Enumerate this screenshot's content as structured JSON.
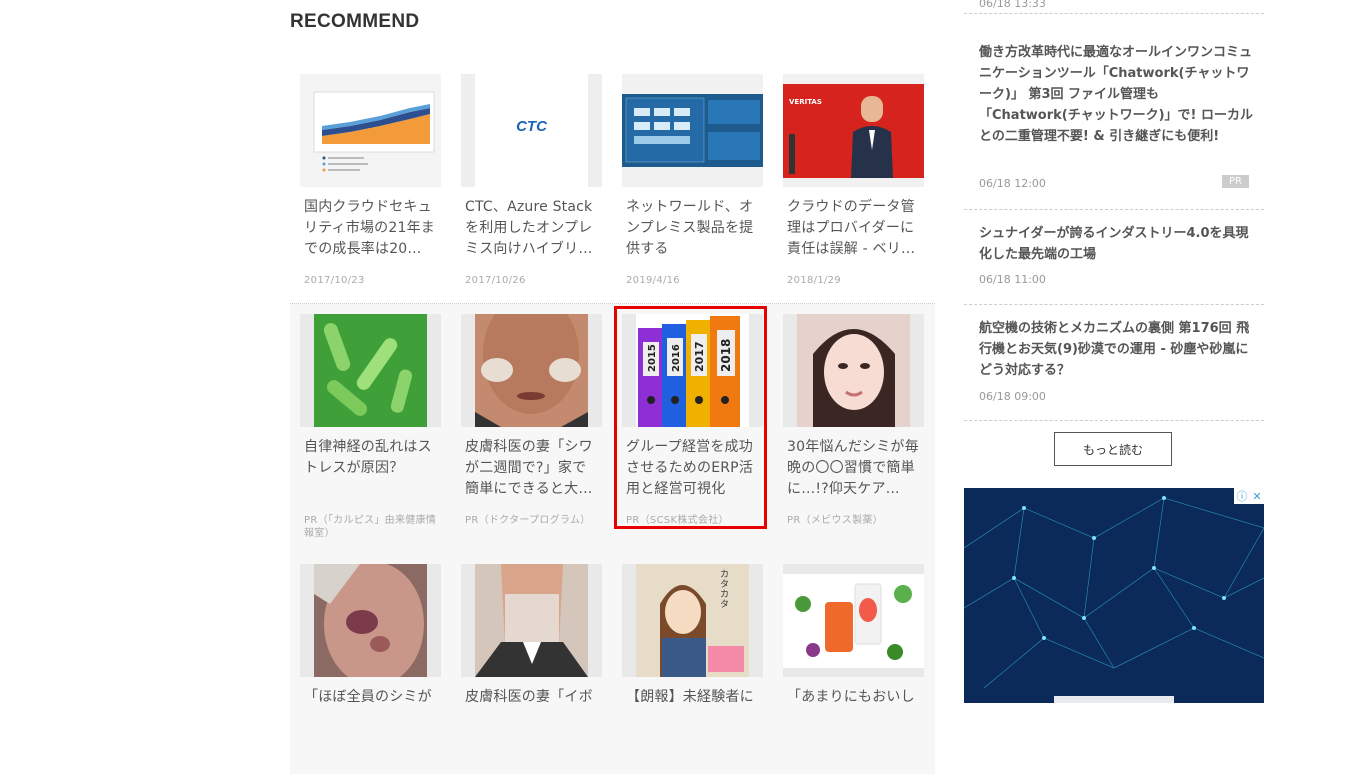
{
  "recommend": {
    "heading": "RECOMMEND",
    "row1": [
      {
        "title": "国内クラウドセキュリティ市場の21年までの成長率は20…",
        "date": "2017/10/23",
        "thumb": "chart-thumbnail"
      },
      {
        "title": "CTC、Azure Stackを利用したオンプレミス向けハイブリ…",
        "date": "2017/10/26",
        "thumb": "ctc-logo",
        "logo_text": "CTC"
      },
      {
        "title": "ネットワールド、オンプレミス製品を提供するStratoscale…",
        "date": "2019/4/16",
        "thumb": "diagram-thumbnail"
      },
      {
        "title": "クラウドのデータ管理はプロバイダーに責任は誤解 - ベリ…",
        "date": "2018/1/29",
        "thumb": "speaker-photo",
        "logo_text": "VERITAS"
      }
    ],
    "row2": [
      {
        "title": "自律神経の乱れはストレスが原因？",
        "source": "PR（「カルピス」由来健康情報室）",
        "thumb": "bacteria-image"
      },
      {
        "title": "皮膚科医の妻「シワが二週間で?」家で簡単にできると大…",
        "source": "PR（ドクタープログラム）",
        "thumb": "face-cream-photo"
      },
      {
        "title": "グループ経営を成功させるためのERP活用と経営可視化",
        "source": "PR（SCSK株式会社）",
        "thumb": "binders-image",
        "binder_years": [
          "2015",
          "2016",
          "2017",
          "2018"
        ]
      },
      {
        "title": "30年悩んだシミが毎晩の〇〇習慣で簡単に…!?仰天ケア…",
        "source": "PR（メビウス製薬）",
        "thumb": "woman-photo"
      }
    ],
    "row3": [
      {
        "title": "「ほぼ全員のシミが",
        "thumb": "face-spot-photo"
      },
      {
        "title": "皮膚科医の妻「イボ",
        "thumb": "neck-photo"
      },
      {
        "title": "【朗報】未経験者に",
        "thumb": "manga-thumbnail",
        "manga_text": "カタカタ"
      },
      {
        "title": "「あまりにもおいし",
        "thumb": "juice-photo"
      }
    ]
  },
  "sidebar": {
    "top_date": "06/18 13:33",
    "items": [
      {
        "title": "働き方改革時代に最適なオールインワンコミュニケーションツール「Chatwork(チャットワーク)」 第3回 ファイル管理も「Chatwork(チャットワーク)」で! ローカルとの二重管理不要! & 引き継ぎにも便利!",
        "date": "06/18 12:00",
        "badge": "PR"
      },
      {
        "title": "シュナイダーが誇るインダストリー4.0を具現化した最先端の工場",
        "date": "06/18 11:00"
      },
      {
        "title": "航空機の技術とメカニズムの裏側 第176回 飛行機とお天気(9)砂漠での運用 - 砂塵や砂嵐にどう対応する？",
        "date": "06/18 09:00"
      }
    ],
    "more_label": "もっと読む",
    "ad_icons": [
      "ⓘ",
      "✕"
    ]
  },
  "colors": {
    "highlight": "#e60000",
    "pr_bg": "#f7f7f7",
    "text": "#555555"
  }
}
